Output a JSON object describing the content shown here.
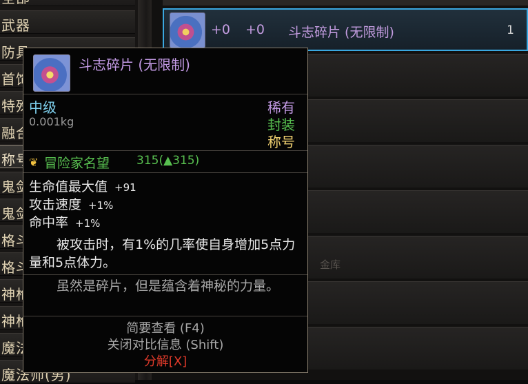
{
  "categories": [
    {
      "label": "全部",
      "active": false
    },
    {
      "label": "武器",
      "active": false
    },
    {
      "label": "防具",
      "active": false
    },
    {
      "label": "首饰",
      "active": false
    },
    {
      "label": "特殊",
      "active": false
    },
    {
      "label": "融合",
      "active": false
    },
    {
      "label": "称号",
      "active": true
    },
    {
      "label": "鬼剑",
      "active": false
    },
    {
      "label": "鬼剑",
      "active": false
    },
    {
      "label": "格斗",
      "active": false
    },
    {
      "label": "格斗",
      "active": false
    },
    {
      "label": "神枪",
      "active": false
    },
    {
      "label": "神枪手(女)",
      "active": false
    },
    {
      "label": "魔法师(男)",
      "active": false
    },
    {
      "label": "魔法师(男)",
      "active": false
    }
  ],
  "list": {
    "selected_item": {
      "enhance": "+0",
      "amplify": "+0",
      "name": "斗志碎片 (无限制)",
      "count": "1"
    },
    "ghost_text": "金库"
  },
  "tooltip": {
    "name": "斗志碎片 (无限制)",
    "grade": "中级",
    "weight": "0.001kg",
    "rarity": "稀有",
    "seal": "封装",
    "type": "称号",
    "reputation": {
      "label": "冒险家名望",
      "value": "315(▲315)"
    },
    "stats": [
      {
        "name": "生命值最大值",
        "value": "+91"
      },
      {
        "name": "攻击速度",
        "value": "+1%"
      },
      {
        "name": "命中率",
        "value": "+1%"
      }
    ],
    "effect": "被攻击时，有1%的几率使自身增加5点力量和5点体力。",
    "flavor": "虽然是碎片，但是蕴含着神秘的力量。",
    "hint_detail": "简要查看 (F4)",
    "hint_compare": "关闭对比信息 (Shift)",
    "decompose": "分解[X]"
  },
  "colors": {
    "rare": "#c49be6",
    "grade": "#7fd2f0",
    "seal": "#58c050",
    "title_type": "#f0d070",
    "decompose": "#e03a2a",
    "selection_border": "#3aa8e0"
  }
}
